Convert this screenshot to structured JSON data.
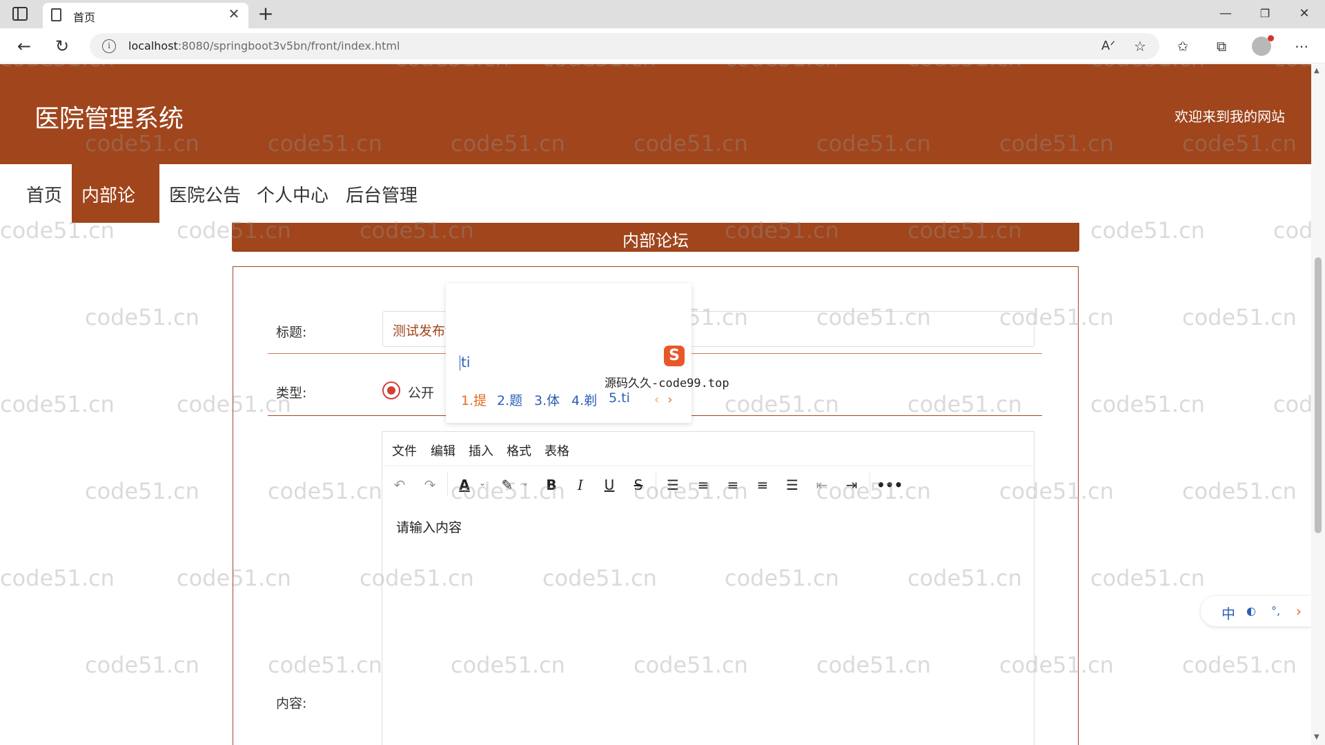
{
  "browser": {
    "tab_title": "首页",
    "url_host": "localhost",
    "url_path": ":8080/springboot3v5bn/front/index.html"
  },
  "site": {
    "title": "医院管理系统",
    "welcome": "欢迎来到我的网站",
    "brand_color": "#a0451c"
  },
  "nav": {
    "items": [
      {
        "label": "首页"
      },
      {
        "label": "内部论坛"
      },
      {
        "label": "医院公告"
      },
      {
        "label": "个人中心"
      },
      {
        "label": "后台管理"
      }
    ],
    "active": "内部论坛"
  },
  "section": {
    "title": "内部论坛"
  },
  "form": {
    "title_label": "标题:",
    "title_value": "测试发布ti",
    "type_label": "类型:",
    "type_option": "公开",
    "content_label": "内容:"
  },
  "editor": {
    "menu": [
      "文件",
      "编辑",
      "插入",
      "格式",
      "表格"
    ],
    "placeholder": "请输入内容",
    "toolbar_icons": [
      "undo-icon",
      "redo-icon",
      "font-color-icon",
      "highlight-icon",
      "bold-icon",
      "italic-icon",
      "underline-icon",
      "strikethrough-icon",
      "bullet-list-icon",
      "align-left-icon",
      "align-center-icon",
      "align-right-icon",
      "align-justify-icon",
      "outdent-icon",
      "indent-icon",
      "more-icon"
    ]
  },
  "ime": {
    "input": "ti",
    "candidates": [
      "1.提",
      "2.题",
      "3.体",
      "4.剃",
      "5.ti"
    ],
    "watermark_text": "源码久久-code99.top",
    "status": [
      "中",
      "◐",
      "°,"
    ]
  },
  "watermark": "code51.cn"
}
